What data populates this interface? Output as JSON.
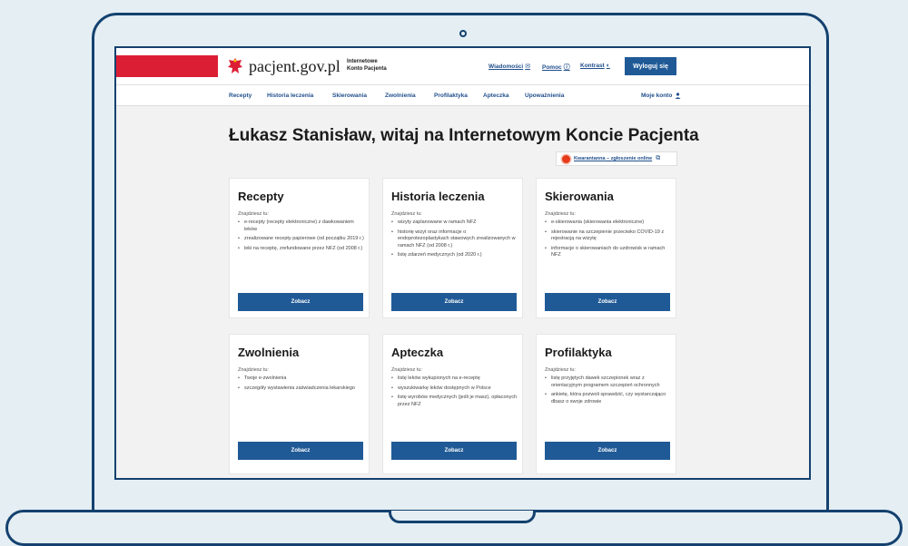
{
  "header": {
    "site_name": "pacjent.gov.pl",
    "site_sub": "Internetowe Konto Pacjenta",
    "messages": "Wiadomości",
    "help": "Pomoc",
    "contrast": "Kontrast",
    "logout": "Wyloguj się"
  },
  "nav": {
    "items": [
      "Recepty",
      "Historia leczenia",
      "Skierowania",
      "Zwolnienia",
      "Profilaktyka",
      "Apteczka",
      "Upoważnienia"
    ],
    "account": "Moje konto"
  },
  "main": {
    "title": "Łukasz Stanisław, witaj na Internetowym Koncie Pacjenta",
    "corona_link": "Kwarantanna – zgłoszenie online"
  },
  "cards": [
    {
      "title": "Recepty",
      "intro": "Znajdziesz tu:",
      "items": [
        "e-recepty (recepty elektroniczne) z dawkowaniem leków",
        "zrealizowane recepty papierowe (od początku 2019 r.)",
        "leki na receptę, zrefundowane przez NFZ (od 2008 r.)"
      ],
      "button": "Zobacz"
    },
    {
      "title": "Historia leczenia",
      "intro": "Znajdziesz tu:",
      "items": [
        "wizyty zaplanowane w ramach NFZ",
        "historię wizyt oraz informacje o endoprotezoplastykach stawowych zrealizowanych w ramach NFZ (od 2008 r.)",
        "listę zdarzeń medycznych (od 2020 r.)"
      ],
      "button": "Zobacz"
    },
    {
      "title": "Skierowania",
      "intro": "Znajdziesz tu:",
      "items": [
        "e-skierowania (skierowania elektroniczne)",
        "skierowanie na szczepienie przeciwko COVID-19 z rejestracją na wizytę",
        "informacje o skierowaniach do uzdrowisk w ramach NFZ"
      ],
      "button": "Zobacz"
    },
    {
      "title": "Zwolnienia",
      "intro": "Znajdziesz tu:",
      "items": [
        "Twoje e-zwolnienia",
        "szczegóły wystawienia zaświadczenia lekarskiego"
      ],
      "button": "Zobacz"
    },
    {
      "title": "Apteczka",
      "intro": "Znajdziesz tu:",
      "items": [
        "listę leków wykupionych na e-receptę",
        "wyszukiwarkę leków dostępnych w Polsce",
        "listę wyrobów medycznych (jeśli je masz), opłaconych przez NFZ"
      ],
      "button": "Zobacz"
    },
    {
      "title": "Profilaktyka",
      "intro": "Znajdziesz tu:",
      "items": [
        "listę przyjętych dawek szczepionek wraz z orientacyjnym programem szczepień ochronnych",
        "ankietę, która pozwoli sprawdzić, czy wystarczająco dbasz o swoje zdrowie"
      ],
      "button": "Zobacz"
    }
  ],
  "colors": {
    "primary": "#1f5a96",
    "link": "#1f4e8c",
    "brand_red": "#dc1e35",
    "frame": "#14416f",
    "background": "#e4eef3"
  }
}
